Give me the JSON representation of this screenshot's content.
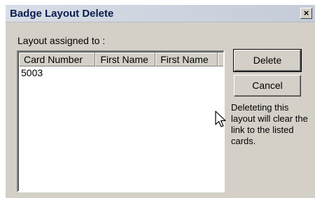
{
  "window": {
    "title": "Badge Layout Delete",
    "close_glyph": "×"
  },
  "main": {
    "label": "Layout assigned to :",
    "columns": [
      "Card Number",
      "First Name",
      "First Name"
    ],
    "rows": [
      [
        "5003",
        "",
        ""
      ]
    ],
    "note": "Deleteting this layout will clear the link to the listed cards."
  },
  "buttons": {
    "delete_label": "Delete",
    "cancel_label": "Cancel"
  },
  "icons": {
    "cursor": "arrow-cursor-icon",
    "close": "close-icon"
  }
}
